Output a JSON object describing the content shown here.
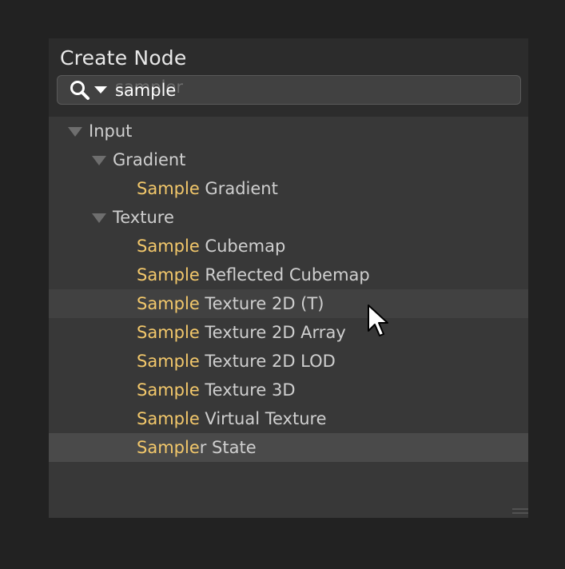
{
  "window": {
    "title": "Create Node"
  },
  "search": {
    "query": "sample",
    "placeholder": "sampler",
    "icon": "search-icon",
    "dropdown_icon": "chevron-down-icon"
  },
  "colors": {
    "highlight_text": "#f3c86b",
    "panel_bg": "#383838",
    "header_bg": "#2c2c2c"
  },
  "tree": [
    {
      "label": "Input",
      "expanded": true
    },
    {
      "label": "Gradient",
      "expanded": true
    },
    {
      "match": "Sample",
      "rest": " Gradient"
    },
    {
      "label": "Texture",
      "expanded": true
    },
    {
      "match": "Sample",
      "rest": " Cubemap"
    },
    {
      "match": "Sample",
      "rest": " Reflected Cubemap"
    },
    {
      "match": "Sample",
      "rest": " Texture 2D (T)",
      "hovered": true
    },
    {
      "match": "Sample",
      "rest": " Texture 2D Array"
    },
    {
      "match": "Sample",
      "rest": " Texture 2D LOD"
    },
    {
      "match": "Sample",
      "rest": " Texture 3D"
    },
    {
      "match": "Sample",
      "rest": " Virtual Texture"
    },
    {
      "match": "Sample",
      "rest": "r State",
      "selected": true
    }
  ]
}
